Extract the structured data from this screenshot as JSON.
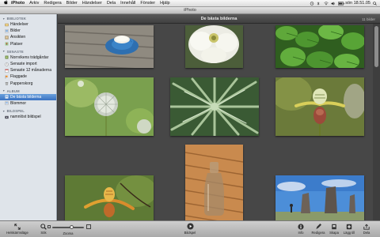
{
  "menubar": {
    "items": [
      "iPhoto",
      "Arkiv",
      "Redigera",
      "Bilder",
      "Händelser",
      "Dela",
      "Innehåll",
      "Fönster",
      "Hjälp"
    ],
    "clock": "sön 18.51.05"
  },
  "window": {
    "title": "iPhoto"
  },
  "sidebar": {
    "sections": [
      {
        "label": "BIBLIOTEK",
        "items": [
          {
            "label": "Händelser",
            "icon": "events-icon"
          },
          {
            "label": "Bilder",
            "icon": "photos-icon"
          },
          {
            "label": "Ansikten",
            "icon": "faces-icon"
          },
          {
            "label": "Platser",
            "icon": "places-icon"
          }
        ]
      },
      {
        "label": "SENASTE",
        "items": [
          {
            "label": "Norrvikens trädgårdar",
            "icon": "event-thumbnail-icon"
          },
          {
            "label": "Senaste import",
            "icon": "clock-icon"
          },
          {
            "label": "Senaste 12 månaderna",
            "icon": "calendar-icon"
          },
          {
            "label": "Flaggade",
            "icon": "flag-icon"
          },
          {
            "label": "Papperskorg",
            "icon": "trash-icon"
          }
        ]
      },
      {
        "label": "ALBUM",
        "items": [
          {
            "label": "De bästa bilderna",
            "icon": "album-icon",
            "selected": true
          },
          {
            "label": "Blommor",
            "icon": "album-icon"
          }
        ]
      },
      {
        "label": "BILDSPEL",
        "items": [
          {
            "label": "namnlöst bildspel",
            "icon": "slideshow-icon"
          }
        ]
      }
    ]
  },
  "main": {
    "title": "De bästa bilderna",
    "count": "11 bilder",
    "photos": [
      {
        "name": "photo-coffee-cup"
      },
      {
        "name": "photo-white-flower"
      },
      {
        "name": "photo-green-leaves"
      },
      {
        "name": "photo-thistle"
      },
      {
        "name": "photo-agave"
      },
      {
        "name": "photo-orchid"
      },
      {
        "name": "photo-wood-bottle"
      },
      {
        "name": "photo-orchid-2"
      },
      {
        "name": "photo-standing-stones"
      }
    ]
  },
  "toolbar": {
    "fullscreen": "Helskärmsläge",
    "search": "Sök",
    "zoom": "Zooma",
    "zoom_level": 0.62,
    "slideshow": "Bildspel",
    "info": "Info",
    "edit": "Redigera",
    "create": "Skapa",
    "add_to": "Lägg till",
    "share": "Dela"
  },
  "colors": {
    "selection": "#3a72c2",
    "sidebar": "#dfe4ea",
    "grid_bg": "#474747"
  }
}
